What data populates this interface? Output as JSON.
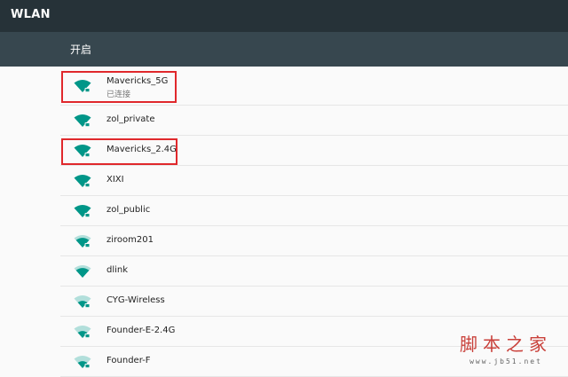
{
  "header": {
    "title": "WLAN"
  },
  "switch": {
    "label": "开启"
  },
  "networks": [
    {
      "ssid": "Mavericks_5G",
      "status": "已连接",
      "signal": "full"
    },
    {
      "ssid": "zol_private",
      "signal": "full"
    },
    {
      "ssid": "Mavericks_2.4G",
      "signal": "full"
    },
    {
      "ssid": "XIXI",
      "signal": "full"
    },
    {
      "ssid": "zol_public",
      "signal": "full"
    },
    {
      "ssid": "ziroom201",
      "signal": "medium"
    },
    {
      "ssid": "dlink",
      "signal": "medium"
    },
    {
      "ssid": "CYG-Wireless",
      "signal": "weak"
    },
    {
      "ssid": "Founder-E-2.4G",
      "signal": "weak"
    },
    {
      "ssid": "Founder-F",
      "signal": "weak"
    }
  ],
  "colors": {
    "toolbar": "#263238",
    "switchbar": "#37474f",
    "wifi": "#009688",
    "highlight": "#e0282c"
  },
  "watermark": {
    "line1": "脚本之家",
    "line2": "www.jb51.net"
  }
}
